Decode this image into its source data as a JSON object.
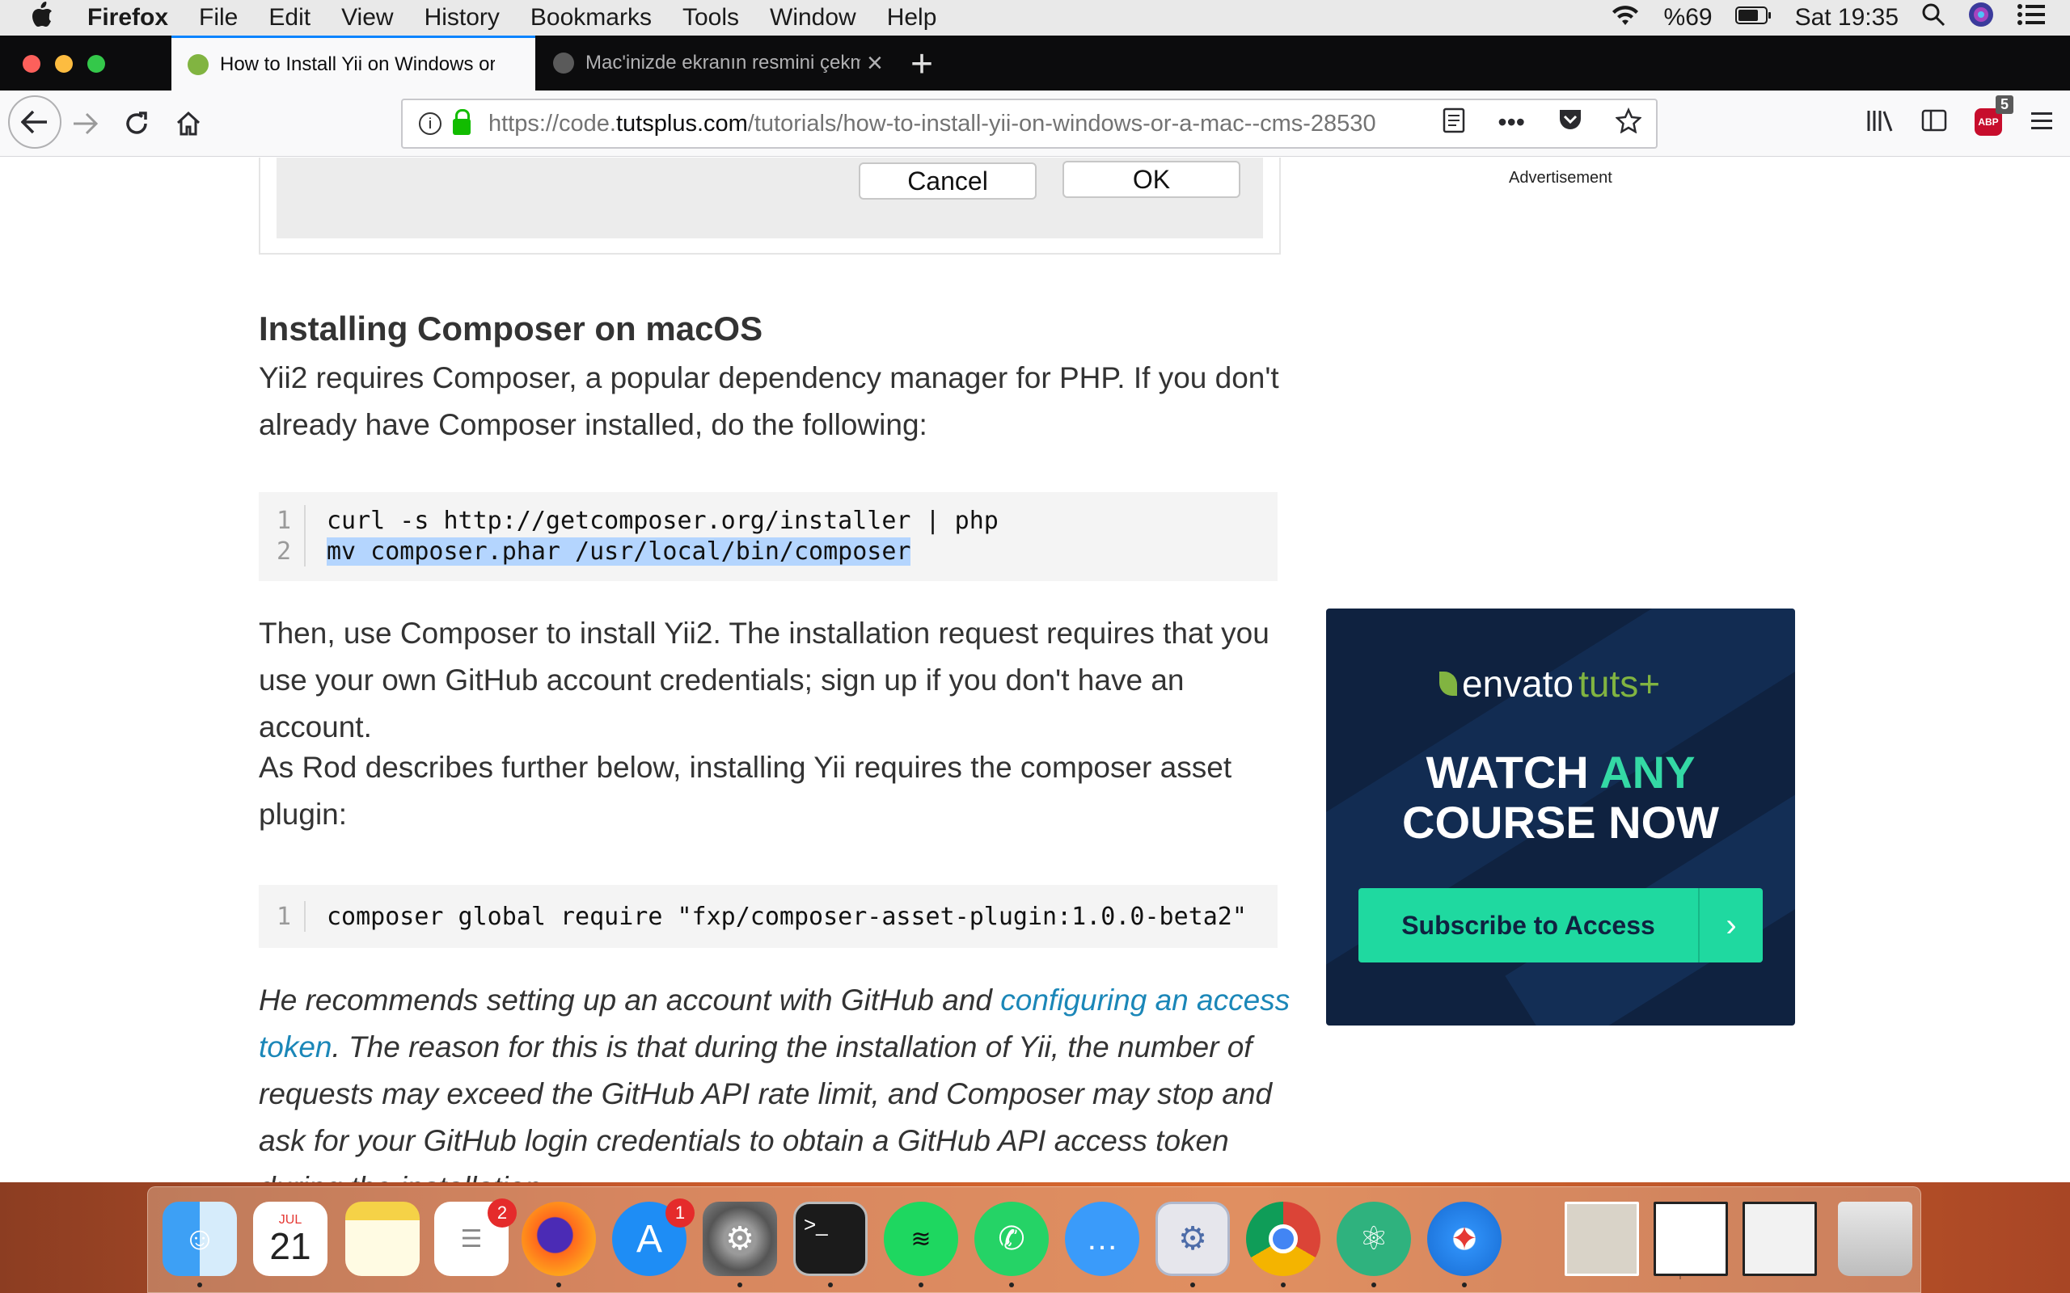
{
  "menubar": {
    "apple": "",
    "app": "Firefox",
    "items": [
      "File",
      "Edit",
      "View",
      "History",
      "Bookmarks",
      "Tools",
      "Window",
      "Help"
    ],
    "battery": "%69",
    "clock": "Sat 19:35"
  },
  "tabs": [
    {
      "title": "How to Install Yii on Windows or a Mac",
      "active": true
    },
    {
      "title": "Mac'inizde ekranın resmini çekme",
      "active": false
    }
  ],
  "urlbar": {
    "prefix": "https://code.",
    "domain": "tutsplus.com",
    "path": "/tutorials/how-to-install-yii-on-windows-or-a-mac--cms-28530"
  },
  "toolbar": {
    "abp_label": "ABP",
    "abp_badge": "5"
  },
  "dialog": {
    "cancel_label": "Cancel",
    "ok_label": "OK"
  },
  "advertisement_label": "Advertisement",
  "article": {
    "heading": "Installing Composer on macOS",
    "para1": "Yii2 requires Composer, a popular dependency manager for PHP. If you don't already have Composer installed, do the following:",
    "code1": [
      {
        "n": "1",
        "src": "curl -s http://getcomposer.org/installer | php"
      },
      {
        "n": "2",
        "src": "mv composer.phar /usr/local/bin/composer"
      }
    ],
    "para2": "Then, use Composer to install Yii2. The installation request requires that you use your own GitHub account credentials; sign up if you don't have an account.",
    "para3": "As Rod describes further below, installing Yii requires the composer asset plugin:",
    "code2": [
      {
        "n": "1",
        "src": "composer global require \"fxp/composer-asset-plugin:1.0.0-beta2\""
      }
    ],
    "para4_before": "He recommends setting up an account with GitHub and ",
    "para4_link": "configuring an access token",
    "para4_after": ". The reason for this is that during the installation of Yii, the number of requests may exceed the GitHub API rate limit, and Composer may stop and ask for your GitHub login credentials to obtain a GitHub API access token during the installation."
  },
  "ad": {
    "logo_envato": "envato",
    "logo_tuts": "tuts+",
    "headline_1": "WATCH ",
    "headline_accent": "ANY",
    "headline_2": "COURSE NOW",
    "cta": "Subscribe to Access",
    "cta_arrow": "›"
  },
  "dock": {
    "calendar_month": "JUL",
    "calendar_day": "21",
    "reminders_badge": "2",
    "appstore_badge": "1"
  },
  "colors": {
    "accent": "#0a84ff",
    "link": "#1b87b8",
    "ad_bg": "#0f2240",
    "ad_cta": "#1fd9a0"
  }
}
